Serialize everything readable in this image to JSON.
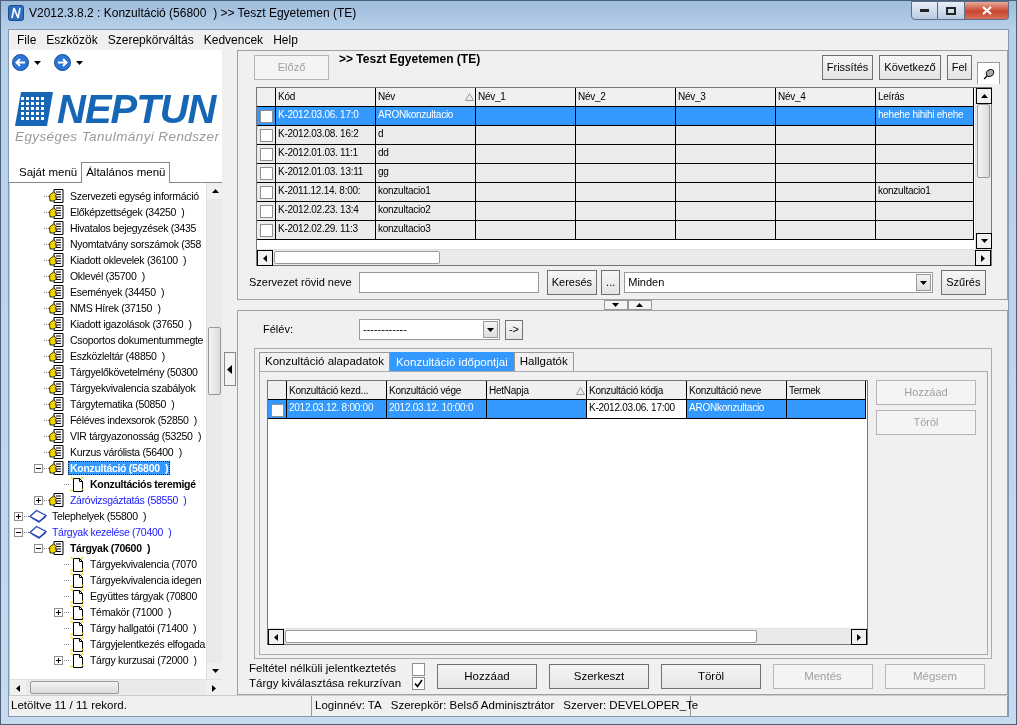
{
  "window": {
    "title": "V2012.3.8.2 : Konzultáció (56800  ) >> Teszt Egyetemen (TE)"
  },
  "menu": [
    "File",
    "Eszközök",
    "Szerepkörváltás",
    "Kedvencek",
    "Help"
  ],
  "logo": {
    "name": "NEPTUN",
    "tagline": "Egységes Tanulmányi Rendszer"
  },
  "sidebar_tabs": [
    {
      "label": "Saját menü",
      "selected": false
    },
    {
      "label": "Általános menü",
      "selected": true
    }
  ],
  "tree": [
    {
      "children": [
        {
          "label": "Szervezeti egység információ",
          "kind": "form",
          "selected": false,
          "bold": false,
          "marked": false
        },
        {
          "label": "Előképzettségek (34250  )",
          "kind": "form",
          "selected": false,
          "bold": false,
          "marked": false
        },
        {
          "label": "Hivatalos bejegyzések (3435",
          "kind": "form",
          "selected": false,
          "bold": false,
          "marked": false
        },
        {
          "label": "Nyomtatvány sorszámok (358",
          "kind": "form",
          "selected": false,
          "bold": false,
          "marked": false
        },
        {
          "label": "Kiadott oklevelek (36100  )",
          "kind": "form",
          "selected": false,
          "bold": false,
          "marked": false
        },
        {
          "label": "Oklevél (35700  )",
          "kind": "form",
          "selected": false,
          "bold": false,
          "marked": false
        },
        {
          "label": "Események (34450  )",
          "kind": "form",
          "selected": false,
          "bold": false,
          "marked": false
        },
        {
          "label": "NMS Hírek (37150  )",
          "kind": "form",
          "selected": false,
          "bold": false,
          "marked": false
        },
        {
          "label": "Kiadott igazolások (37650  )",
          "kind": "form",
          "selected": false,
          "bold": false,
          "marked": false
        },
        {
          "label": "Csoportos dokumentummegte",
          "kind": "form",
          "selected": false,
          "bold": false,
          "marked": false
        },
        {
          "label": "Eszközleltár (48850  )",
          "kind": "form",
          "selected": false,
          "bold": false,
          "marked": false
        },
        {
          "label": "Tárgyelőkövetelmény (50300",
          "kind": "form",
          "selected": false,
          "bold": false,
          "marked": false
        },
        {
          "label": "Tárgyekvivalencia szabályok",
          "kind": "form",
          "selected": false,
          "bold": false,
          "marked": false
        },
        {
          "label": "Tárgytematika (50850  )",
          "kind": "form",
          "selected": false,
          "bold": false,
          "marked": false
        },
        {
          "label": "Féléves indexsorok (52850  )",
          "kind": "form",
          "selected": false,
          "bold": false,
          "marked": false
        },
        {
          "label": "VIR tárgyazonosság (53250  )",
          "kind": "form",
          "selected": false,
          "bold": false,
          "marked": false
        },
        {
          "label": "Kurzus várólista (56400  )",
          "kind": "form",
          "selected": false,
          "bold": false,
          "marked": false
        },
        {
          "label": "Konzultáció (56800  )",
          "kind": "form",
          "selected": true,
          "bold": true,
          "marked": false,
          "expanded": true,
          "children": [
            {
              "label": "Konzultációs teremigé",
              "kind": "page",
              "selected": false,
              "bold": true,
              "marked": false
            }
          ]
        },
        {
          "label": "Záróvizsgáztatás (58550  )",
          "kind": "form",
          "selected": false,
          "bold": false,
          "marked": true,
          "expanded": false
        }
      ]
    },
    {
      "label": "Telephelyek (55800  )",
      "kind": "book",
      "selected": false,
      "bold": false,
      "marked": false,
      "expanded": false
    },
    {
      "label": "Tárgyak kezelése (70400  )",
      "kind": "book",
      "selected": false,
      "bold": false,
      "marked": true,
      "expanded": true,
      "children": [
        {
          "label": "Tárgyak (70600  )",
          "kind": "form",
          "selected": false,
          "bold": true,
          "marked": false,
          "expanded": true,
          "children": [
            {
              "label": "Tárgyekvivalencia (7070",
              "kind": "page",
              "selected": false,
              "bold": false,
              "marked": false
            },
            {
              "label": "Tárgyekvivalencia idegen",
              "kind": "page",
              "selected": false,
              "bold": false,
              "marked": false
            },
            {
              "label": "Együttes tárgyak (70800",
              "kind": "page",
              "selected": false,
              "bold": false,
              "marked": false
            },
            {
              "label": "Témakör (71000  )",
              "kind": "page",
              "selected": false,
              "bold": false,
              "marked": false,
              "expanded": false
            },
            {
              "label": "Tárgy hallgatói (71400  )",
              "kind": "page",
              "selected": false,
              "bold": false,
              "marked": false
            },
            {
              "label": "Tárgyjelentkezés elfogada",
              "kind": "page",
              "selected": false,
              "bold": false,
              "marked": false
            },
            {
              "label": "Tárgy kurzusai (72000  )",
              "kind": "page",
              "selected": false,
              "bold": false,
              "marked": false,
              "expanded": false
            }
          ]
        }
      ]
    }
  ],
  "toolbar": {
    "prev": {
      "label": "Előző",
      "disabled": true
    },
    "heading": ">> Teszt Egyetemen (TE)",
    "buttons": [
      {
        "label": "Frissítés",
        "disabled": false
      },
      {
        "label": "Következő",
        "disabled": false
      },
      {
        "label": "Fel",
        "disabled": false
      }
    ]
  },
  "table": {
    "columns": [
      {
        "label": "Kód",
        "sorted": false
      },
      {
        "label": "Név",
        "sorted": true
      },
      {
        "label": "Név_1",
        "sorted": false
      },
      {
        "label": "Név_2",
        "sorted": false
      },
      {
        "label": "Név_3",
        "sorted": false
      },
      {
        "label": "Név_4",
        "sorted": false
      },
      {
        "label": "Leírás",
        "sorted": false
      }
    ],
    "rows": [
      {
        "checked": false,
        "selected": true,
        "cells": [
          "K-2012.03.06. 17:0",
          "ARONkonzultacio",
          null,
          null,
          null,
          null,
          "hehehe hihihi ehehe"
        ]
      },
      {
        "checked": false,
        "selected": false,
        "cells": [
          "K-2012.03.08. 16:2",
          "d",
          null,
          null,
          null,
          null,
          null
        ]
      },
      {
        "checked": false,
        "selected": false,
        "cells": [
          "K-2012.01.03. 11:1",
          "dd",
          null,
          null,
          null,
          null,
          null
        ]
      },
      {
        "checked": false,
        "selected": false,
        "cells": [
          "K-2012.01.03. 13:11",
          "gg",
          null,
          null,
          null,
          null,
          null
        ]
      },
      {
        "checked": false,
        "selected": false,
        "cells": [
          "K-2011.12.14. 8:00:",
          "konzultacio1",
          null,
          null,
          null,
          null,
          "konzultacio1"
        ]
      },
      {
        "checked": false,
        "selected": false,
        "cells": [
          "K-2012.02.23. 13:4",
          "konzultacio2",
          null,
          null,
          null,
          null,
          null
        ]
      },
      {
        "checked": false,
        "selected": false,
        "cells": [
          "K-2012.02.29. 11:3",
          "konzultacio3",
          null,
          null,
          null,
          null,
          null
        ]
      }
    ]
  },
  "filter": {
    "label": "Szervezet rövid neve",
    "search_button": "Keresés",
    "more_button": "...",
    "scope": "Minden",
    "filter_button": "Szűrés"
  },
  "semester": {
    "label": "Félév:",
    "value": "------------",
    "go_button": "->"
  },
  "detail_tabs": [
    {
      "label": "Konzultáció alapadatok",
      "selected": false
    },
    {
      "label": "Konzultáció időpontjai",
      "selected": true
    },
    {
      "label": "Hallgatók",
      "selected": false
    }
  ],
  "detail_table": {
    "columns": [
      {
        "label": "Konzultáció kezd...",
        "sorted": false
      },
      {
        "label": "Konzultáció vége",
        "sorted": false
      },
      {
        "label": "HetNapja",
        "sorted": true
      },
      {
        "label": "Konzultáció kódja",
        "sorted": false
      },
      {
        "label": "Konzultáció neve",
        "sorted": false
      },
      {
        "label": "Termek",
        "sorted": false
      }
    ],
    "rows": [
      {
        "checked": false,
        "selected": true,
        "cells": [
          {
            "text": "2012.03.12. 8:00:00",
            "focused": false
          },
          {
            "text": "2012.03.12. 10:00:0",
            "focused": false
          },
          {
            "text": null,
            "focused": false
          },
          {
            "text": "K-2012.03.06. 17:00",
            "focused": true
          },
          {
            "text": "ARONkonzultacio",
            "focused": false
          },
          {
            "text": null,
            "focused": false
          }
        ]
      }
    ]
  },
  "detail_buttons": [
    {
      "label": "Hozzáad",
      "disabled": true
    },
    {
      "label": "Töröl",
      "disabled": true
    }
  ],
  "options": [
    {
      "label": "Feltétel nélküli jelentkeztetés",
      "checked": false
    },
    {
      "label": "Tárgy kiválasztása rekurzívan",
      "checked": true
    }
  ],
  "actions": [
    {
      "label": "Hozzáad",
      "disabled": false
    },
    {
      "label": "Szerkeszt",
      "disabled": false
    },
    {
      "label": "Töröl",
      "disabled": false
    },
    {
      "label": "Mentés",
      "disabled": true
    },
    {
      "label": "Mégsem",
      "disabled": true
    }
  ],
  "status_bar": {
    "records": "Letöltve 11 / 11 rekord.",
    "session": [
      "Loginnév: TA",
      "Szerepkör: Belső Adminisztrátor",
      "Szerver: DEVELOPER_Te"
    ]
  }
}
